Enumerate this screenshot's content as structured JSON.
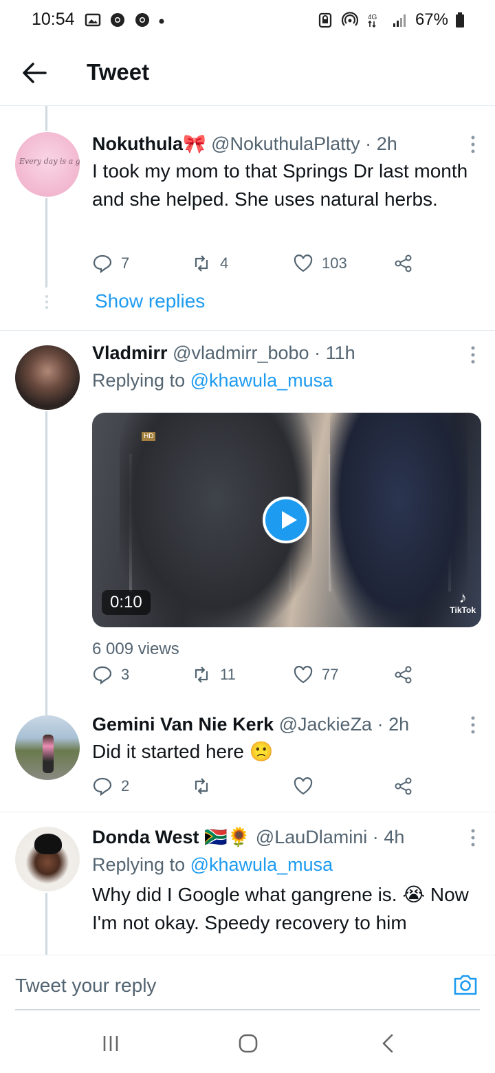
{
  "status_bar": {
    "time": "10:54",
    "battery": "67%",
    "network": "4G"
  },
  "header": {
    "title": "Tweet"
  },
  "tweets": [
    {
      "name": "Nokuthula",
      "name_emoji": "🎀",
      "handle": "@NokuthulaPlatty",
      "time": "2h",
      "avatar_text": "Every day is a gift",
      "text": "I took my mom to that Springs Dr last month and she helped. She uses natural herbs.",
      "replies": "7",
      "retweets": "4",
      "likes": "103",
      "show_replies": "Show replies"
    },
    {
      "name": "Vladmirr",
      "handle": "@vladmirr_bobo",
      "time": "11h",
      "replying_prefix": "Replying to",
      "replying_to": "@khawula_musa",
      "video": {
        "duration": "0:10",
        "badge": "HD",
        "watermark": "TikTok"
      },
      "views": "6 009 views",
      "replies": "3",
      "retweets": "11",
      "likes": "77"
    },
    {
      "name": "Gemini Van Nie Kerk",
      "handle": "@JackieZa",
      "time": "2h",
      "text": "Did it started here 🙁",
      "replies": "2",
      "retweets": "",
      "likes": ""
    },
    {
      "name": "Donda West",
      "name_emoji": "🇿🇦🌻",
      "handle": "@LauDlamini",
      "time": "4h",
      "replying_prefix": "Replying to",
      "replying_to": "@khawula_musa",
      "text": "Why did I Google what gangrene is. 😭 Now I'm not okay. Speedy recovery to him"
    }
  ],
  "reply_bar": {
    "placeholder": "Tweet your reply"
  },
  "colors": {
    "accent": "#1d9bf0",
    "text": "#0f1419",
    "muted": "#536471",
    "divider": "#e6ecf0"
  }
}
